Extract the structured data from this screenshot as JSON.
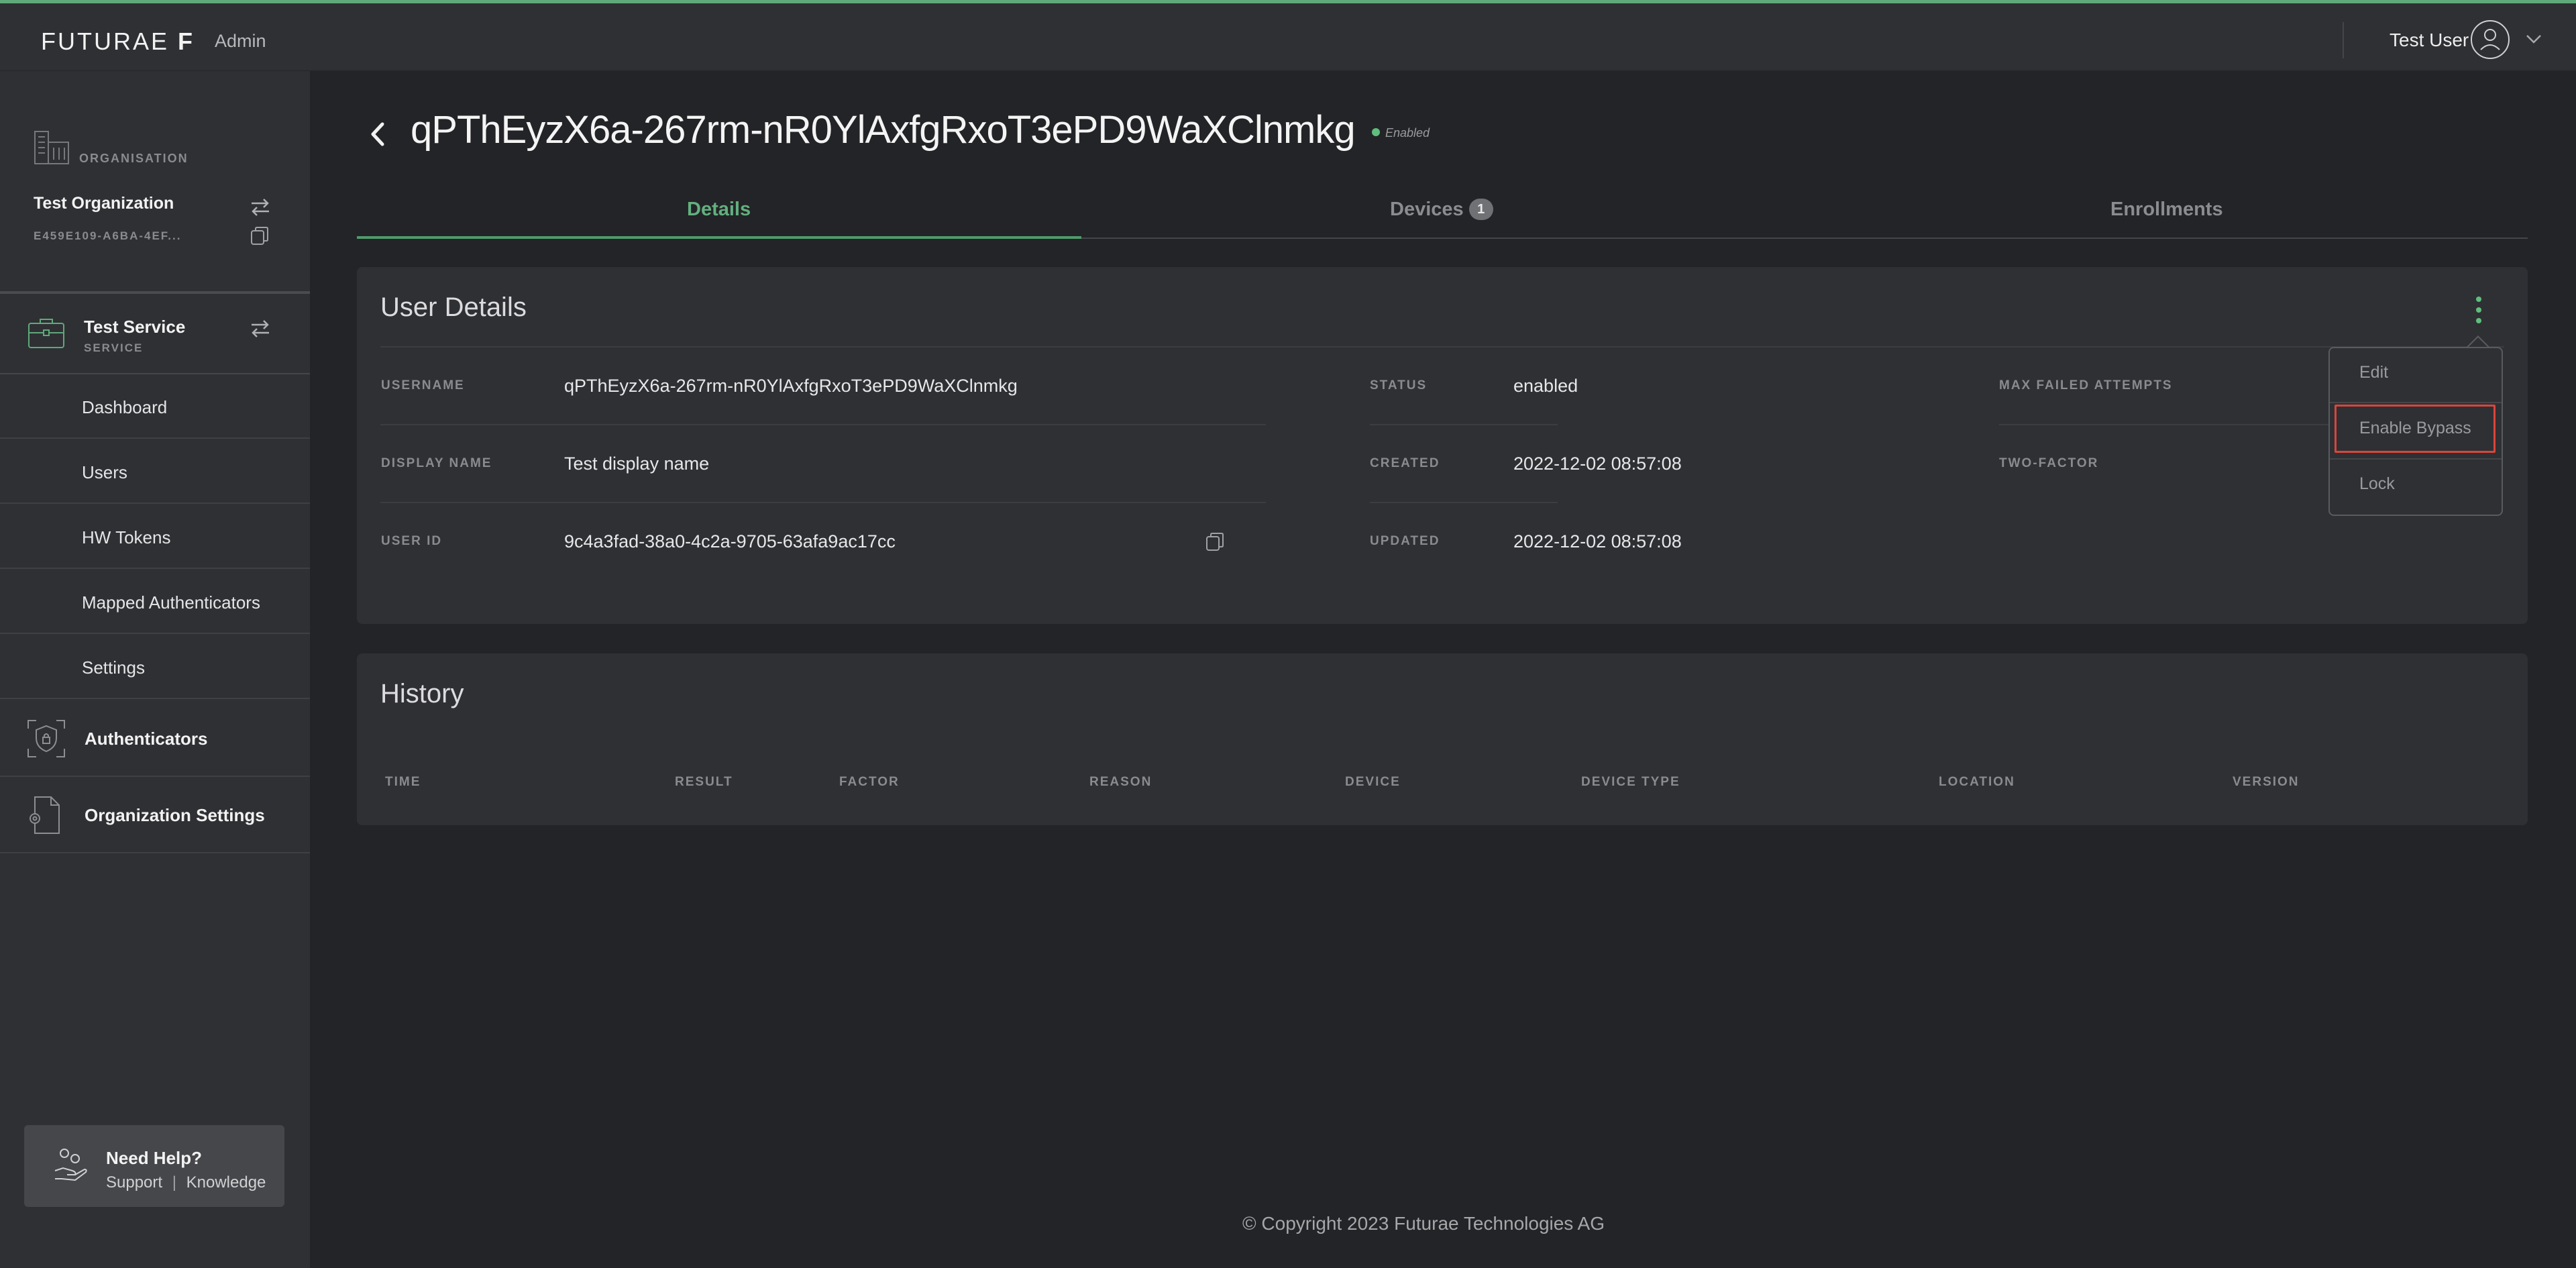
{
  "header": {
    "logo_text": "FUTURAE",
    "logo_mark": "F",
    "app_section": "Admin",
    "user_name": "Test User"
  },
  "sidebar": {
    "org_label": "ORGANISATION",
    "org_name": "Test Organization",
    "org_id": "E459E109-A6BA-4EF...",
    "service_name": "Test Service",
    "service_label": "SERVICE",
    "items": [
      {
        "label": "Dashboard"
      },
      {
        "label": "Users"
      },
      {
        "label": "HW Tokens"
      },
      {
        "label": "Mapped Authenticators"
      },
      {
        "label": "Settings"
      }
    ],
    "authenticators_label": "Authenticators",
    "org_settings_label": "Organization Settings",
    "help": {
      "title": "Need Help?",
      "support": "Support",
      "separator": "|",
      "knowledge": "Knowledge"
    }
  },
  "page": {
    "title": "qPThEyzX6a-267rm-nR0YlAxfgRxoT3ePD9WaXClnmkg",
    "status": "Enabled"
  },
  "tabs": [
    {
      "label": "Details",
      "active": true
    },
    {
      "label": "Devices",
      "badge": "1",
      "active": false
    },
    {
      "label": "Enrollments",
      "active": false
    }
  ],
  "user_details": {
    "title": "User Details",
    "username_label": "USERNAME",
    "username": "qPThEyzX6a-267rm-nR0YlAxfgRxoT3ePD9WaXClnmkg",
    "display_name_label": "DISPLAY NAME",
    "display_name": "Test display name",
    "user_id_label": "USER ID",
    "user_id": "9c4a3fad-38a0-4c2a-9705-63afa9ac17cc",
    "status_label": "STATUS",
    "status": "enabled",
    "created_label": "CREATED",
    "created": "2022-12-02 08:57:08",
    "updated_label": "UPDATED",
    "updated": "2022-12-02 08:57:08",
    "max_failed_label": "MAX FAILED ATTEMPTS",
    "two_factor_label": "TWO-FACTOR"
  },
  "actions_menu": {
    "items": [
      {
        "label": "Edit"
      },
      {
        "label": "Enable Bypass"
      },
      {
        "label": "Lock"
      }
    ]
  },
  "history": {
    "title": "History",
    "columns": [
      "TIME",
      "RESULT",
      "FACTOR",
      "REASON",
      "DEVICE",
      "DEVICE TYPE",
      "LOCATION",
      "VERSION"
    ]
  },
  "footer": {
    "copyright": "© Copyright 2023 Futurae Technologies AG"
  },
  "colors": {
    "accent_green": "#63b07f",
    "highlight_red": "#d9463b",
    "background": "#232427",
    "panel": "#2f3034"
  }
}
